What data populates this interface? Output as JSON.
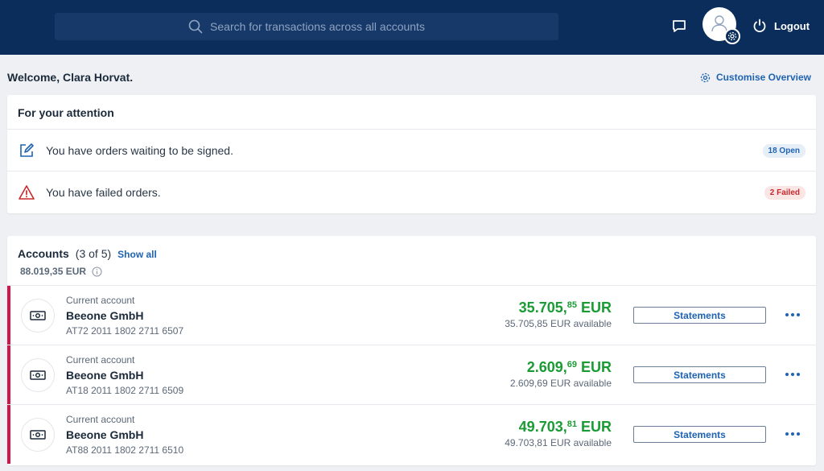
{
  "header": {
    "search_placeholder": "Search for transactions across all accounts",
    "logout_label": "Logout"
  },
  "welcome": {
    "text": "Welcome, Clara Horvat.",
    "customise_label": "Customise Overview"
  },
  "attention": {
    "title": "For your attention",
    "items": [
      {
        "text": "You have orders waiting to be signed.",
        "badge": "18 Open",
        "icon": "edit-icon"
      },
      {
        "text": "You have failed orders.",
        "badge": "2 Failed",
        "icon": "warning-icon"
      }
    ]
  },
  "accounts": {
    "title": "Accounts",
    "count": "(3 of 5)",
    "show_all_label": "Show all",
    "total": "88.019,35 EUR",
    "statements_label": "Statements",
    "items": [
      {
        "type": "Current account",
        "name": "Beeone GmbH",
        "iban": "AT72 2011 1802 2711 6507",
        "amount_int": "35.705,",
        "amount_dec": "85",
        "currency": " EUR",
        "available": "35.705,85 EUR available"
      },
      {
        "type": "Current account",
        "name": "Beeone GmbH",
        "iban": "AT18 2011 1802 2711 6509",
        "amount_int": "2.609,",
        "amount_dec": "69",
        "currency": " EUR",
        "available": "2.609,69 EUR available"
      },
      {
        "type": "Current account",
        "name": "Beeone GmbH",
        "iban": "AT88 2011 1802 2711 6510",
        "amount_int": "49.703,",
        "amount_dec": "81",
        "currency": " EUR",
        "available": "49.703,81 EUR available"
      }
    ]
  },
  "colors": {
    "header_bg": "#0b2d5c",
    "accent": "#1e63b4",
    "positive": "#1a9b34",
    "danger": "#c6282d",
    "account_stripe": "#d2164b"
  }
}
